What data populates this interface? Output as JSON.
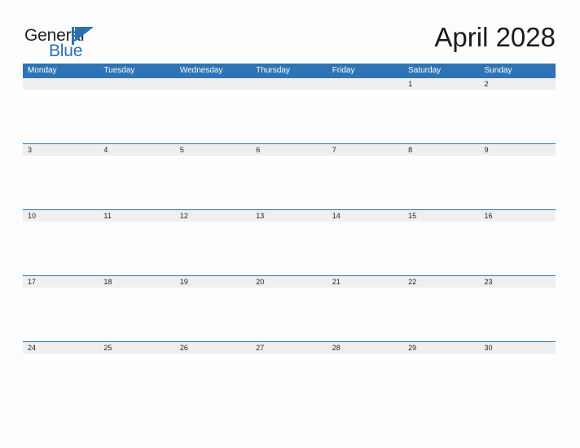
{
  "brand": {
    "logo_word_1": "General",
    "logo_word_2": "Blue",
    "mark_icon": "blue-triangle-flag-icon",
    "color_dark": "#231f20",
    "color_blue": "#2871b5"
  },
  "header": {
    "title": "April 2028"
  },
  "theme": {
    "header_band": "#2e74b5",
    "date_band": "#efefef",
    "separator_line": "#2e74b5",
    "page_background": "#fdfdfd",
    "date_text": "#222222",
    "weekday_text": "#ffffff"
  },
  "calendar": {
    "month": "April",
    "year": "2028",
    "weekday_headers": [
      "Monday",
      "Tuesday",
      "Wednesday",
      "Thursday",
      "Friday",
      "Saturday",
      "Sunday"
    ],
    "weeks": [
      {
        "days": [
          "",
          "",
          "",
          "",
          "",
          "1",
          "2"
        ]
      },
      {
        "days": [
          "3",
          "4",
          "5",
          "6",
          "7",
          "8",
          "9"
        ]
      },
      {
        "days": [
          "10",
          "11",
          "12",
          "13",
          "14",
          "15",
          "16"
        ]
      },
      {
        "days": [
          "17",
          "18",
          "19",
          "20",
          "21",
          "22",
          "23"
        ]
      },
      {
        "days": [
          "24",
          "25",
          "26",
          "27",
          "28",
          "29",
          "30"
        ]
      }
    ]
  }
}
